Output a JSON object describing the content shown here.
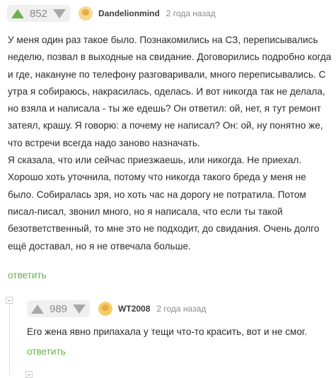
{
  "comment1": {
    "score": "852",
    "username": "Dandelionmind",
    "date": "2 года назад",
    "paragraphs": [
      "У меня один раз такое было. Познакомились на СЗ, переписывались неделю, позвал в выходные на свидание. Договорились подробно когда и где, накануне по телефону разговаривали, много переписывались. С утра я собираюсь, накрасилась, оделась. И вот никогда так не делала, но взяла и написала - ты же едешь? Он ответил: ой, нет, я тут ремонт затеял, крашу. Я говорю: а почему не написал? Он: ой, ну понятно же, что встречи всегда надо заново назначать.",
      "Я сказала, что или сейчас приезжаешь, или никогда. Не приехал. Хорошо хоть уточнила, потому что никогда такого бреда у меня не было. Собиралась зря, но хоть час на дорогу не потратила. Потом писал-писал, звонил много, но я написала, что если ты такой безответственный, то мне это не подходит, до свидания. Очень долго ещё доставал, но я не отвечала больше."
    ],
    "reply_label": "ответить"
  },
  "comment2": {
    "score": "989",
    "username": "WT2008",
    "date": "2 года назад",
    "text": "Его жена явно припахала у тещи что-то красить, вот и не смог.",
    "reply_label": "ответить"
  },
  "icons": {
    "upvote": "arrow-up-icon",
    "downvote": "arrow-down-icon",
    "collapse": "collapse-icon"
  },
  "colors": {
    "accent": "#6bb04a",
    "muted": "#8a8a8a",
    "pill": "#f0f0f0"
  }
}
